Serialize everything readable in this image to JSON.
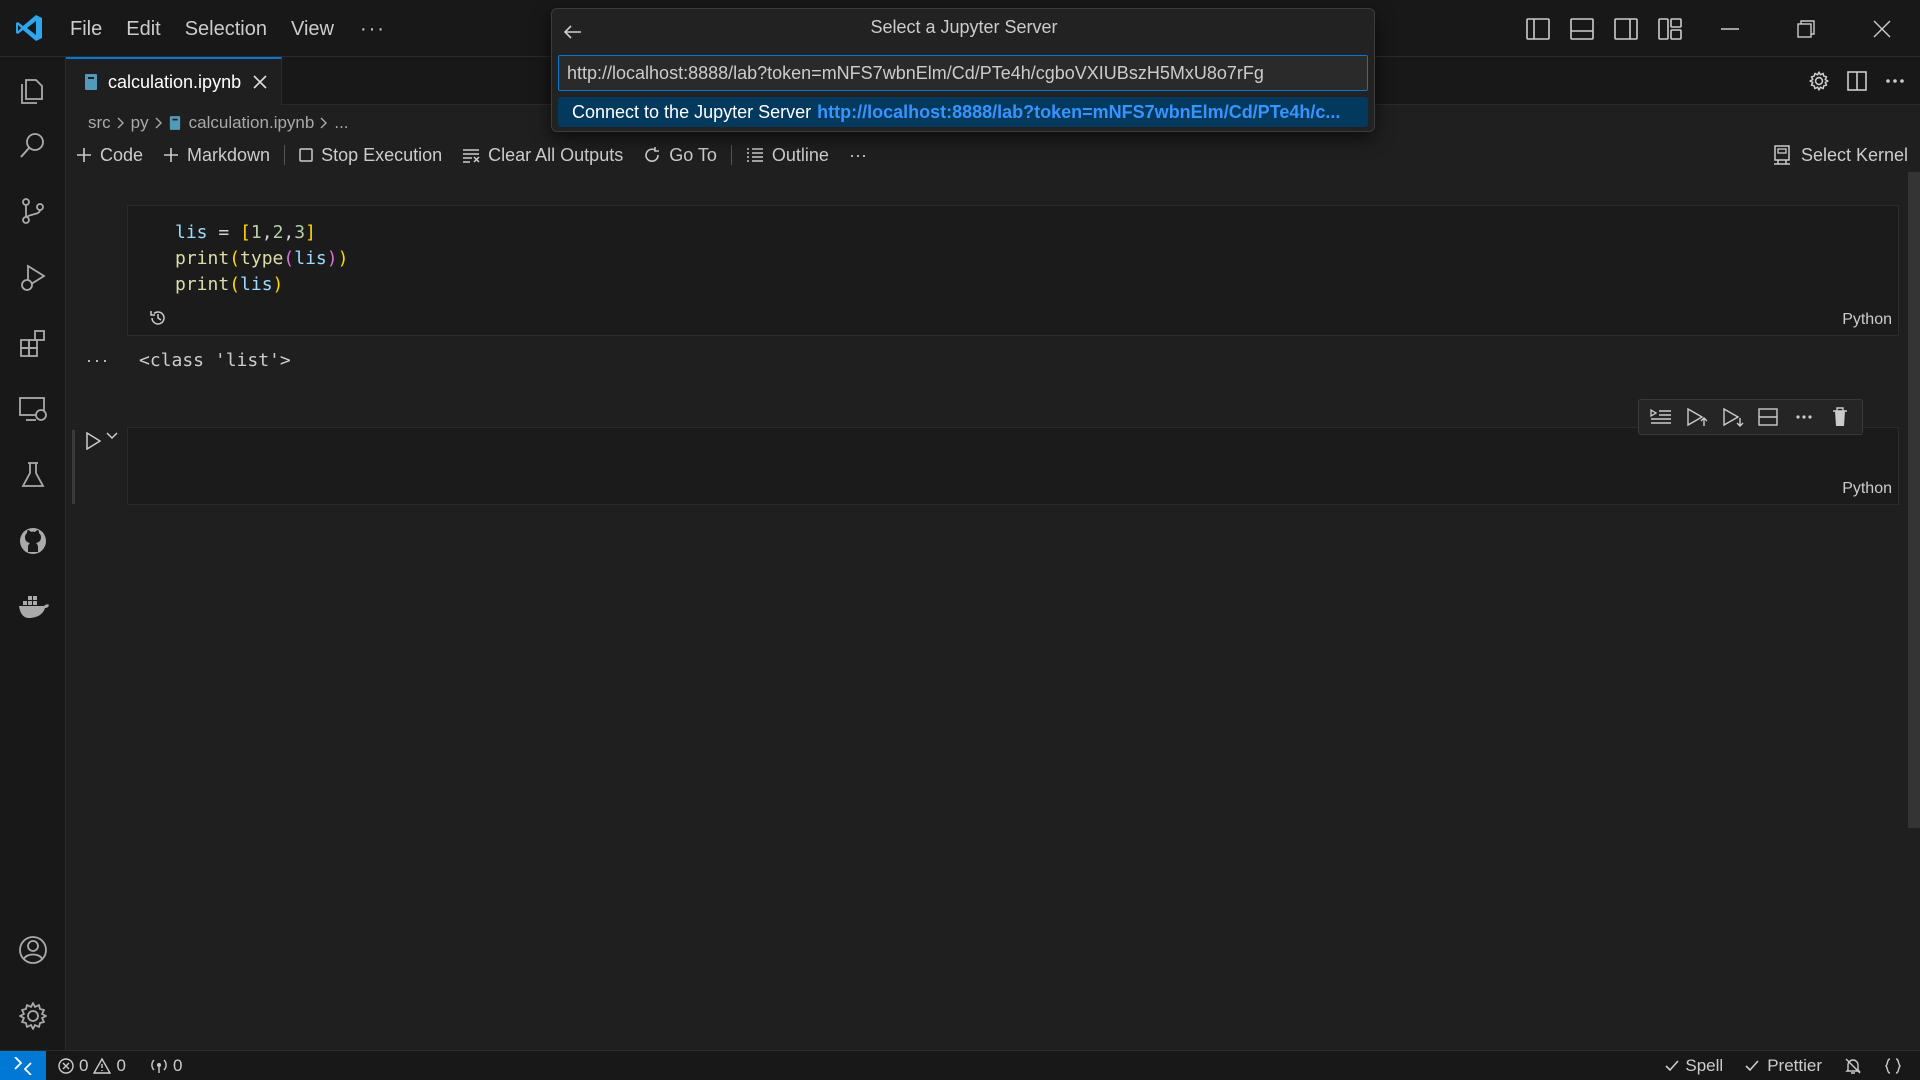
{
  "menubar": {
    "items": [
      "File",
      "Edit",
      "Selection",
      "View"
    ],
    "more": "···"
  },
  "tab": {
    "label": "calculation.ipynb"
  },
  "breadcrumb": {
    "parts": [
      "src",
      "py",
      "calculation.ipynb",
      "..."
    ]
  },
  "toolbar": {
    "code": "Code",
    "markdown": "Markdown",
    "stop_execution": "Stop Execution",
    "clear_all_outputs": "Clear All Outputs",
    "go_to": "Go To",
    "outline": "Outline",
    "more": "···",
    "select_kernel": "Select Kernel"
  },
  "cells": [
    {
      "lines": [
        "lis = [1,2,3]",
        "print(type(lis))",
        "print(lis)"
      ],
      "language": "Python",
      "output": "<class 'list'>",
      "output_more": "···"
    },
    {
      "lines": [],
      "language": "Python"
    }
  ],
  "quickpick": {
    "title": "Select a Jupyter Server",
    "input_value": "http://localhost:8888/lab?token=mNFS7wbnElm/Cd/PTe4h/cgboVXIUBszH5MxU8o7rFg",
    "option_label": "Connect to the Jupyter Server",
    "option_url": "http://localhost:8888/lab?token=mNFS7wbnElm/Cd/PTe4h/c..."
  },
  "statusbar": {
    "errors": "0",
    "warnings": "0",
    "ports": "0",
    "spell": "Spell",
    "prettier": "Prettier"
  },
  "colors": {
    "accent": "#0078d4",
    "link": "#3794ff",
    "selection": "#04395e",
    "background": "#1f1f1f"
  },
  "icons": {
    "activitybar": [
      "explorer-icon",
      "search-icon",
      "source-control-icon",
      "run-debug-icon",
      "extensions-icon",
      "remote-explorer-icon",
      "testing-icon",
      "github-icon",
      "docker-icon",
      "account-icon",
      "manage-gear-icon"
    ]
  }
}
